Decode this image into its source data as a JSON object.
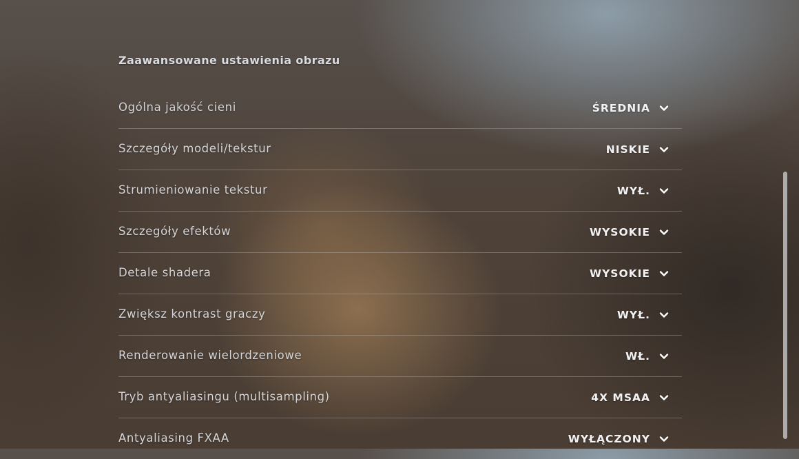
{
  "section": {
    "title": "Zaawansowane ustawienia obrazu"
  },
  "settings": [
    {
      "label": "Ogólna jakość cieni",
      "value": "ŚREDNIA"
    },
    {
      "label": "Szczegóły modeli/tekstur",
      "value": "NISKIE"
    },
    {
      "label": "Strumieniowanie tekstur",
      "value": "WYŁ."
    },
    {
      "label": "Szczegóły efektów",
      "value": "WYSOKIE"
    },
    {
      "label": "Detale shadera",
      "value": "WYSOKIE"
    },
    {
      "label": "Zwiększ kontrast graczy",
      "value": "WYŁ."
    },
    {
      "label": "Renderowanie wielordzeniowe",
      "value": "WŁ."
    },
    {
      "label": "Tryb antyaliasingu (multisampling)",
      "value": "4X MSAA"
    },
    {
      "label": "Antyaliasing FXAA",
      "value": "WYŁĄCZONY"
    }
  ],
  "icons": {
    "dropdown": "chevron-down-icon"
  },
  "colors": {
    "label_text": "#d4d5d8",
    "value_text": "#f2f2f4",
    "divider": "#bebab4",
    "scrollbar_thumb": "#d7d7da"
  }
}
